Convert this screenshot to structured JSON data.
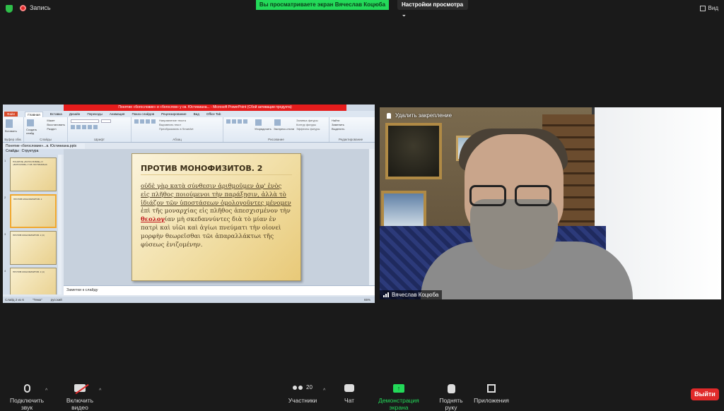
{
  "topbar": {
    "recording_label": "Запись",
    "share_banner": "Вы просматриваете экран Вячеслав Коцюба",
    "view_options": "Настройки просмотра",
    "view_button": "Вид"
  },
  "powerpoint": {
    "window_title": "Понятие «богословие» и «богослов» у св. Юстиниана... - Microsoft PowerPoint (Сбой активации продукта)",
    "ribbon_tabs": [
      "Файл",
      "Главная",
      "Вставка",
      "Дизайн",
      "Переходы",
      "Анимация",
      "Показ слайдов",
      "Рецензирование",
      "Вид",
      "Office Tab"
    ],
    "ribbon_groups": [
      "Буфер обм.",
      "Слайды",
      "Шрифт",
      "Абзац",
      "Рисование",
      "Редактирование"
    ],
    "ribbon_labels": {
      "create_slide": "Создать слайд",
      "layout": "Макет",
      "reset": "Восстановить",
      "section": "Раздел",
      "arrange": "Упорядочить",
      "quick_styles": "Экспресс-стили",
      "find": "Найти",
      "replace": "Заменить",
      "select": "Выделить",
      "text_direction": "Направление текста",
      "align_text": "Выровнять текст",
      "smartart": "Преобразовать в SmartArt",
      "paste": "Вставить",
      "shape_fill": "Заливка фигуры",
      "shape_outline": "Контур фигуры",
      "shape_effects": "Эффекты фигуры"
    },
    "doc_tab": "Понятие «богословие»...в. Юстиниана.pptx",
    "panel_tabs": [
      "Слайды",
      "Структура"
    ],
    "thumb_numbers": [
      "1",
      "2",
      "3",
      "4"
    ],
    "thumb_texts": [
      "ПОНЯТИЕ «БОГОСЛОВИЕ» И «БОГОСЛОВ» У СВ. ЮСТИНИАНА",
      "ПРОТИВ МОНОФИЗИТОВ. 2",
      "ПРОТИВ МОНОФИЗИТОВ. 2 (3)",
      "ПРОТИВ МОНОФИЗИТОВ. 2 (4)"
    ],
    "slide_title": "ПРОТИВ МОНОФИЗИТОВ. 2",
    "slide_text_underlined": "οὐδὲ γὰρ κατὰ σύνθεσιν ἀριθμοῦμεν ἀφ' ἑνὸς εἰς πλῆθος ποιούμενοι τὴν παράξησιν, ἀλλὰ τὸ ἰδιάζον τῶν ὑποστάσεων ὁμολογοῦντες μένομεν",
    "slide_text_mid": " ἐπὶ τῆς μοναρχίας εἰς πλῆθος ἀπεσχισμένον τὴν ",
    "slide_text_red": "θεολογ",
    "slide_text_end": "ίαν μὴ σκεδαννύντες διὰ τὸ μίαν ἐν πατρὶ καὶ υἱῶι καὶ ἁγίωι πνεύματι τὴν οἱονεὶ μορφὴν θεωρεῖσθαι τῶι ἀπαραλλάκτωι τῆς φύσεως ἑνιζομένην.",
    "notes_placeholder": "Заметки к слайду",
    "status": [
      "Слайд 2 из 6",
      "\"Тема\"",
      "русский"
    ],
    "zoom": "65%"
  },
  "video": {
    "unpin_label": "Удалить закрепление",
    "participant_name": "Вячеслав Коцюба"
  },
  "bottombar": {
    "audio": "Подключить звук",
    "video": "Включить видео",
    "participants": "Участники",
    "participants_count": "20",
    "chat": "Чат",
    "share": "Демонстрация экрана",
    "raise_hand": "Поднять руку",
    "apps": "Приложения",
    "leave": "Выйти"
  },
  "colors": {
    "share_green": "#23d959",
    "leave_red": "#e02a2a"
  }
}
